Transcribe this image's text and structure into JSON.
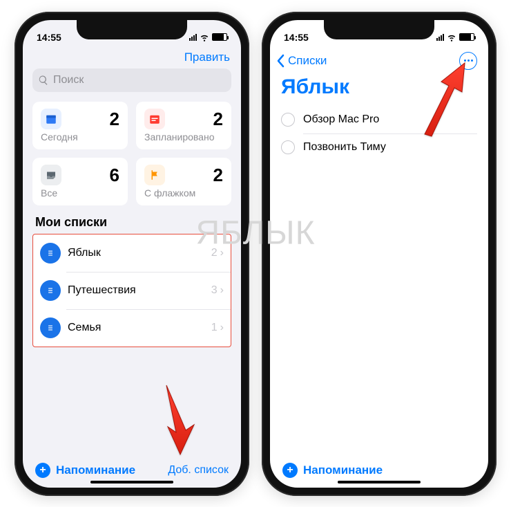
{
  "status": {
    "time": "14:55"
  },
  "left": {
    "edit": "Править",
    "search_placeholder": "Поиск",
    "cards": {
      "today": {
        "label": "Сегодня",
        "count": "2"
      },
      "planned": {
        "label": "Запланировано",
        "count": "2"
      },
      "all": {
        "label": "Все",
        "count": "6"
      },
      "flagged": {
        "label": "С флажком",
        "count": "2"
      }
    },
    "section": "Мои списки",
    "lists": [
      {
        "name": "Яблык",
        "count": "2"
      },
      {
        "name": "Путешествия",
        "count": "3"
      },
      {
        "name": "Семья",
        "count": "1"
      }
    ],
    "add_reminder": "Напоминание",
    "add_list": "Доб. список"
  },
  "right": {
    "back": "Списки",
    "title": "Яблык",
    "reminders": [
      {
        "text": "Обзор Mac Pro"
      },
      {
        "text": "Позвонить Тиму"
      }
    ],
    "add_reminder": "Напоминание"
  },
  "watermark": "ЯБЛЫК"
}
